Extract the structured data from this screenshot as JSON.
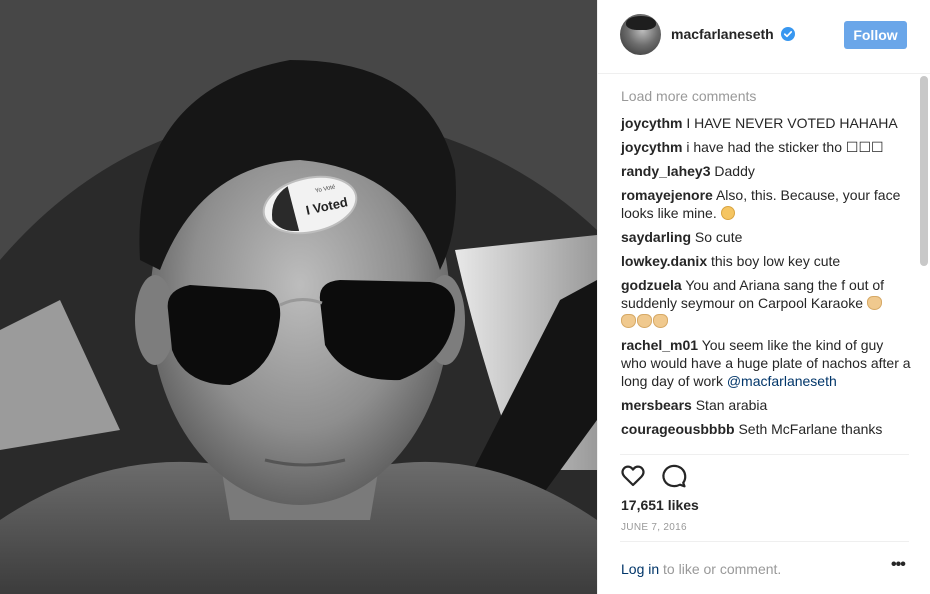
{
  "post": {
    "username": "macfarlaneseth",
    "verified": true,
    "follow_label": "Follow",
    "photo": {
      "sticker_text": "I Voted",
      "sticker_small_text": "Yo Voté"
    }
  },
  "comments_section": {
    "load_more_label": "Load more comments",
    "comments": [
      {
        "user": "joycythm",
        "text": "I HAVE NEVER VOTED HAHAHA"
      },
      {
        "user": "joycythm",
        "text": "i have had the sticker tho ☐☐☐"
      },
      {
        "user": "randy_lahey3",
        "text": "Daddy"
      },
      {
        "user": "romayejenore",
        "text": "Also, this. Because, your face looks like mine."
      },
      {
        "user": "saydarling",
        "text": "So cute"
      },
      {
        "user": "lowkey.danix",
        "text": "this boy low key cute"
      },
      {
        "user": "godzuela",
        "text": "You and Ariana sang the f out of suddenly seymour on Carpool Karaoke"
      },
      {
        "user": "rachel_m01",
        "text": "You seem like the kind of guy who would have a huge plate of nachos after a long day of work",
        "mention": "@macfarlaneseth"
      },
      {
        "user": "mersbears",
        "text": "Stan arabia"
      },
      {
        "user": "courageousbbbb",
        "text": "Seth McFarlane thanks"
      }
    ]
  },
  "actions": {
    "like_icon": "heart-icon",
    "comment_icon": "comment-icon",
    "likes_label": "17,651 likes",
    "date": "JUNE 7, 2016",
    "login_link": "Log in",
    "login_rest": " to like or comment.",
    "more_label": "•••"
  },
  "colors": {
    "follow_button": "#6aa6e9",
    "verified_badge": "#3897f0",
    "link": "#003569",
    "muted": "#999999"
  }
}
